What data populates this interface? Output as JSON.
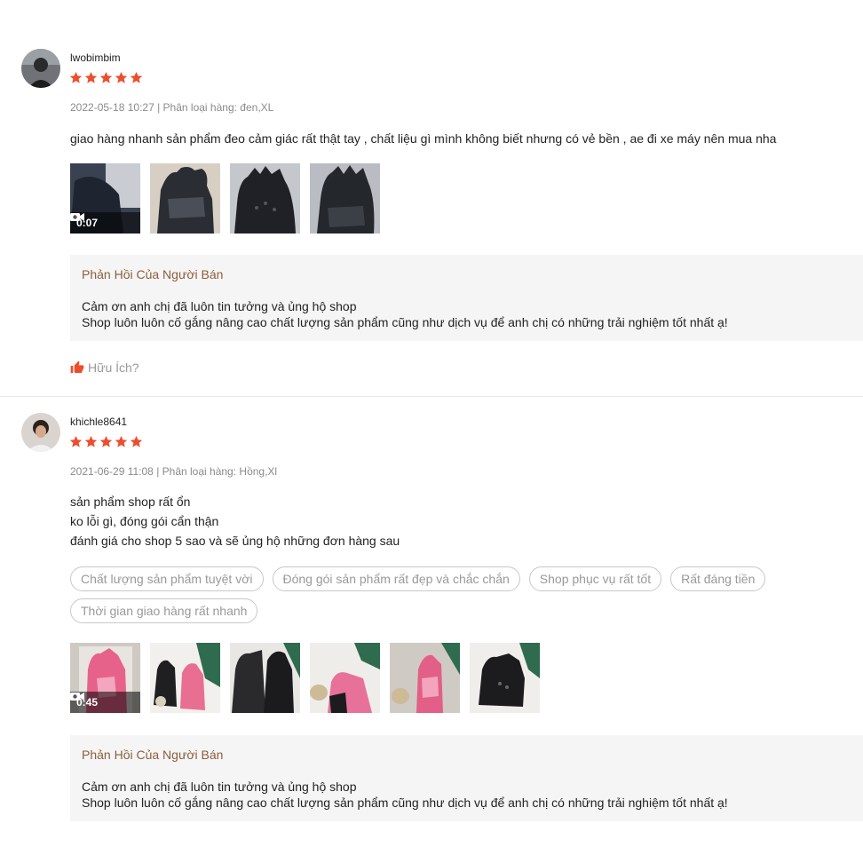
{
  "reviews": [
    {
      "username": "lwobimbim",
      "rating": 5,
      "date": "2022-05-18 10:27",
      "variation_label": "Phân loại hàng:",
      "variation_value": "đen,XL",
      "comment": [
        "giao hàng nhanh sản phẩm đeo cảm giác rất thật tay , chất liệu gì mình không biết nhưng có vẻ bền , ae đi xe máy nên mua nha"
      ],
      "video_duration": "0:07",
      "seller_reply": {
        "title": "Phản Hồi Của Người Bán",
        "line1": "Cảm ơn anh chị đã luôn tin tưởng và ủng hộ shop",
        "line2": "Shop luôn luôn cố gắng nâng cao chất lượng sản phẩm cũng như dịch vụ để anh chị có những trải nghiệm tốt nhất ạ!"
      },
      "helpful_label": "Hữu Ích?"
    },
    {
      "username": "khichle8641",
      "rating": 5,
      "date": "2021-06-29 11:08",
      "variation_label": "Phân loại hàng:",
      "variation_value": "Hồng,Xl",
      "comment": [
        "sản phẩm shop rất ổn",
        "ko lỗi gì, đóng gói cẩn thận",
        "đánh giá cho shop 5 sao và sẽ ủng hộ những đơn hàng sau"
      ],
      "tags": [
        "Chất lượng sản phẩm tuyệt vời",
        "Đóng gói sản phẩm rất đẹp và chắc chắn",
        "Shop phục vụ rất tốt",
        "Rất đáng tiền",
        "Thời gian giao hàng rất nhanh"
      ],
      "video_duration": "0:45",
      "seller_reply": {
        "title": "Phản Hồi Của Người Bán",
        "line1": "Cảm ơn anh chị đã luôn tin tưởng và ủng hộ shop",
        "line2": "Shop luôn luôn cố gắng nâng cao chất lượng sản phẩm cũng như dịch vụ để anh chị có những trải nghiệm tốt nhất ạ!"
      }
    }
  ],
  "icons": {
    "star": "star-icon",
    "video": "video-camera-icon",
    "helpful": "thumbs-up-icon"
  },
  "colors": {
    "accent": "#ee4d2d",
    "reply_title": "#8b5e3c",
    "meta": "#8a8a8a"
  }
}
